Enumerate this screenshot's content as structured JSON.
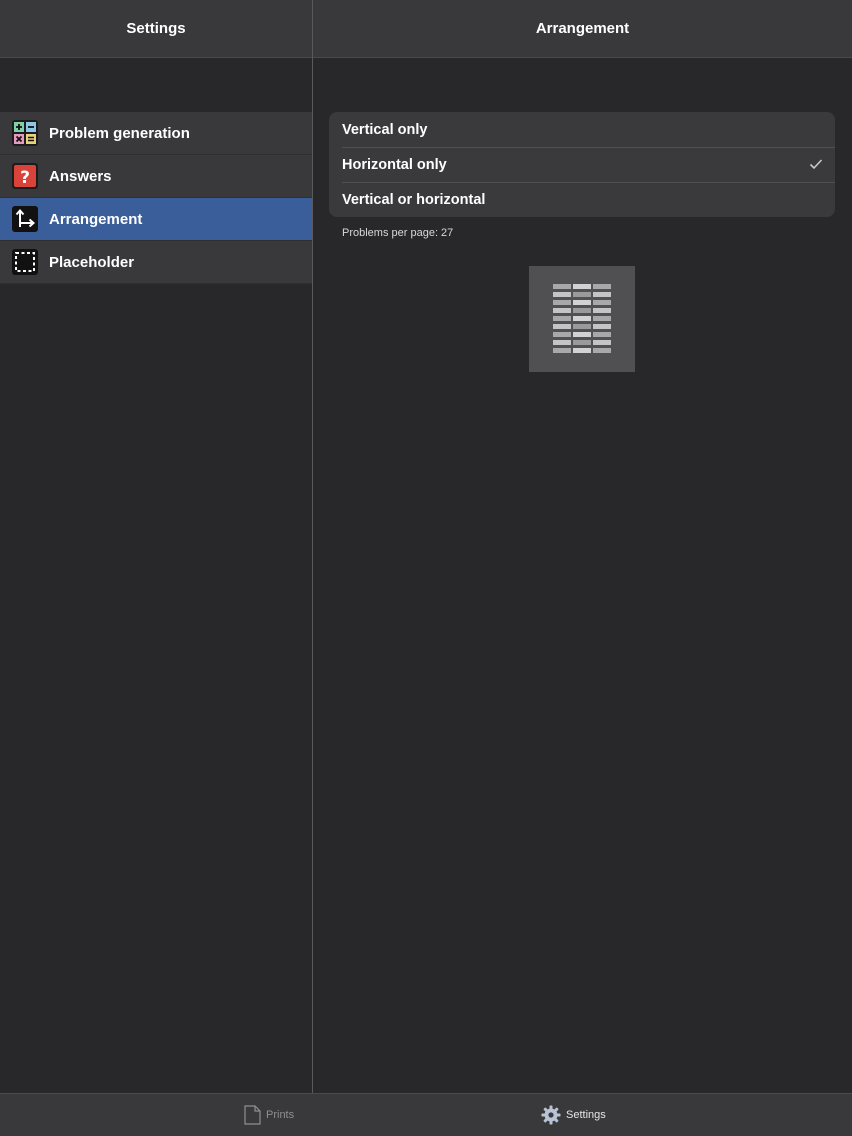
{
  "master": {
    "title": "Settings",
    "items": [
      {
        "label": "Problem generation",
        "icon": "calculator-icon",
        "selected": false
      },
      {
        "label": "Answers",
        "icon": "question-mark-icon",
        "selected": false
      },
      {
        "label": "Arrangement",
        "icon": "arrangement-arrows-icon",
        "selected": true
      },
      {
        "label": "Placeholder",
        "icon": "dashed-square-icon",
        "selected": false
      }
    ]
  },
  "detail": {
    "title": "Arrangement",
    "options": [
      {
        "label": "Vertical only",
        "checked": false
      },
      {
        "label": "Horizontal only",
        "checked": true
      },
      {
        "label": "Vertical or horizontal",
        "checked": false
      }
    ],
    "problems_per_page": "Problems per page: 27"
  },
  "tabbar": {
    "tabs": [
      {
        "label": "Prints",
        "icon": "document-icon",
        "active": false
      },
      {
        "label": "Settings",
        "icon": "gear-icon",
        "active": true
      }
    ]
  },
  "colors": {
    "accent_selected": "#3a5e99",
    "background": "#28282a",
    "bar": "#39393b"
  }
}
